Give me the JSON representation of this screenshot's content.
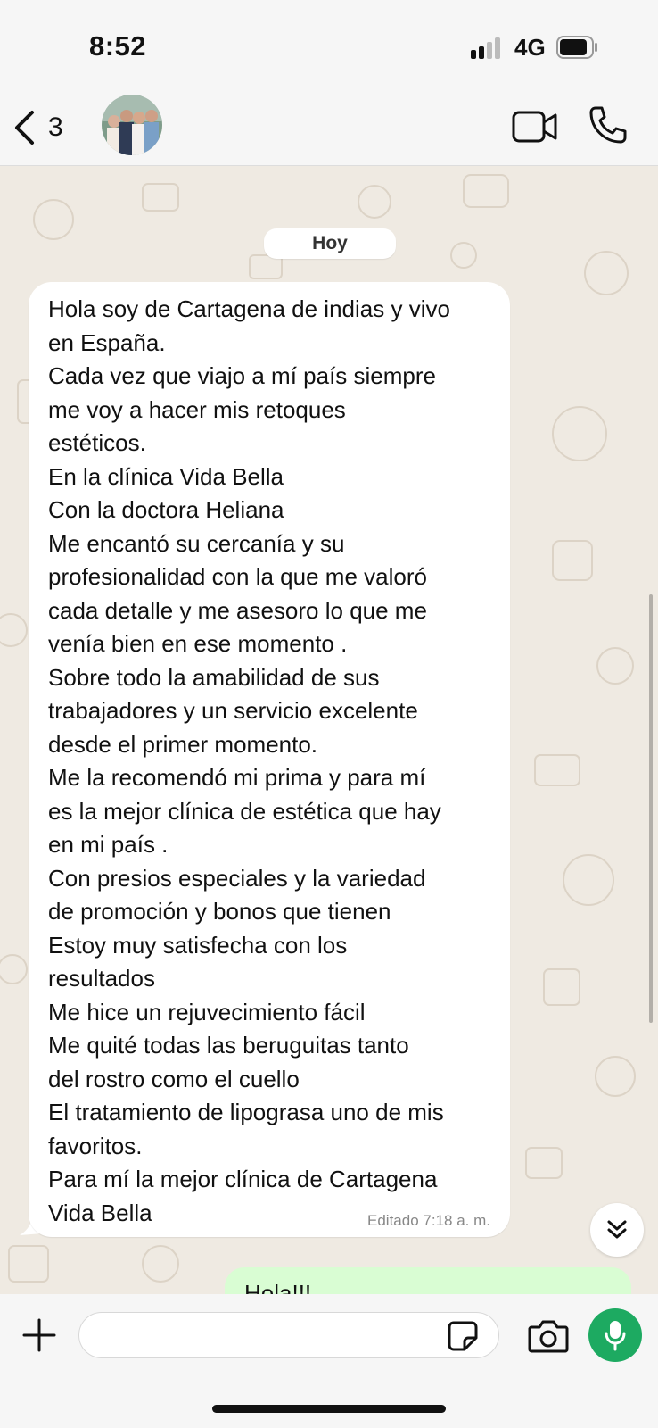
{
  "status_bar": {
    "time": "8:52",
    "network": "4G"
  },
  "header": {
    "back_count": "3",
    "icons": [
      "chevron-left-icon",
      "video-camera-icon",
      "phone-icon"
    ]
  },
  "chat": {
    "date_label": "Hoy",
    "incoming_message": {
      "lines": [
        "Hola soy de Cartagena de indias y vivo",
        "en España.",
        "Cada vez que viajo a mí país siempre",
        "me voy a hacer mis retoques",
        "estéticos.",
        "En la clínica Vida Bella",
        "Con la doctora Heliana",
        "Me encantó su cercanía y su",
        "profesionalidad con la que me valoró",
        "cada detalle y me asesoro lo que me",
        "venía bien en ese momento .",
        "Sobre todo la amabilidad de sus",
        "trabajadores y un servicio excelente",
        "desde el primer momento.",
        "Me la recomendó mi prima y para mí",
        "es la mejor clínica de estética que hay",
        "en mi país .",
        "Con presios especiales y la variedad",
        "de promoción y bonos que tienen",
        "Estoy muy satisfecha con los",
        "resultados",
        "Me hice un rejuvecimiento fácil",
        "Me quité todas las beruguitas tanto",
        "del rostro como el cuello",
        "El tratamiento de lipograsa uno de mis",
        "favoritos.",
        "Para mí la mejor clínica de Cartagena",
        "Vida Bella"
      ],
      "meta": "Editado 7:18 a. m."
    },
    "outgoing_message_partial": "Hola!!!"
  },
  "composer": {
    "input_value": "",
    "icons": [
      "plus-icon",
      "sticker-icon",
      "camera-icon",
      "microphone-icon"
    ]
  },
  "colors": {
    "chat_background": "#efeae2",
    "incoming_bubble": "#ffffff",
    "outgoing_bubble": "#d9fdd3",
    "mic_button": "#1daa61",
    "bars": "#f6f6f6"
  }
}
